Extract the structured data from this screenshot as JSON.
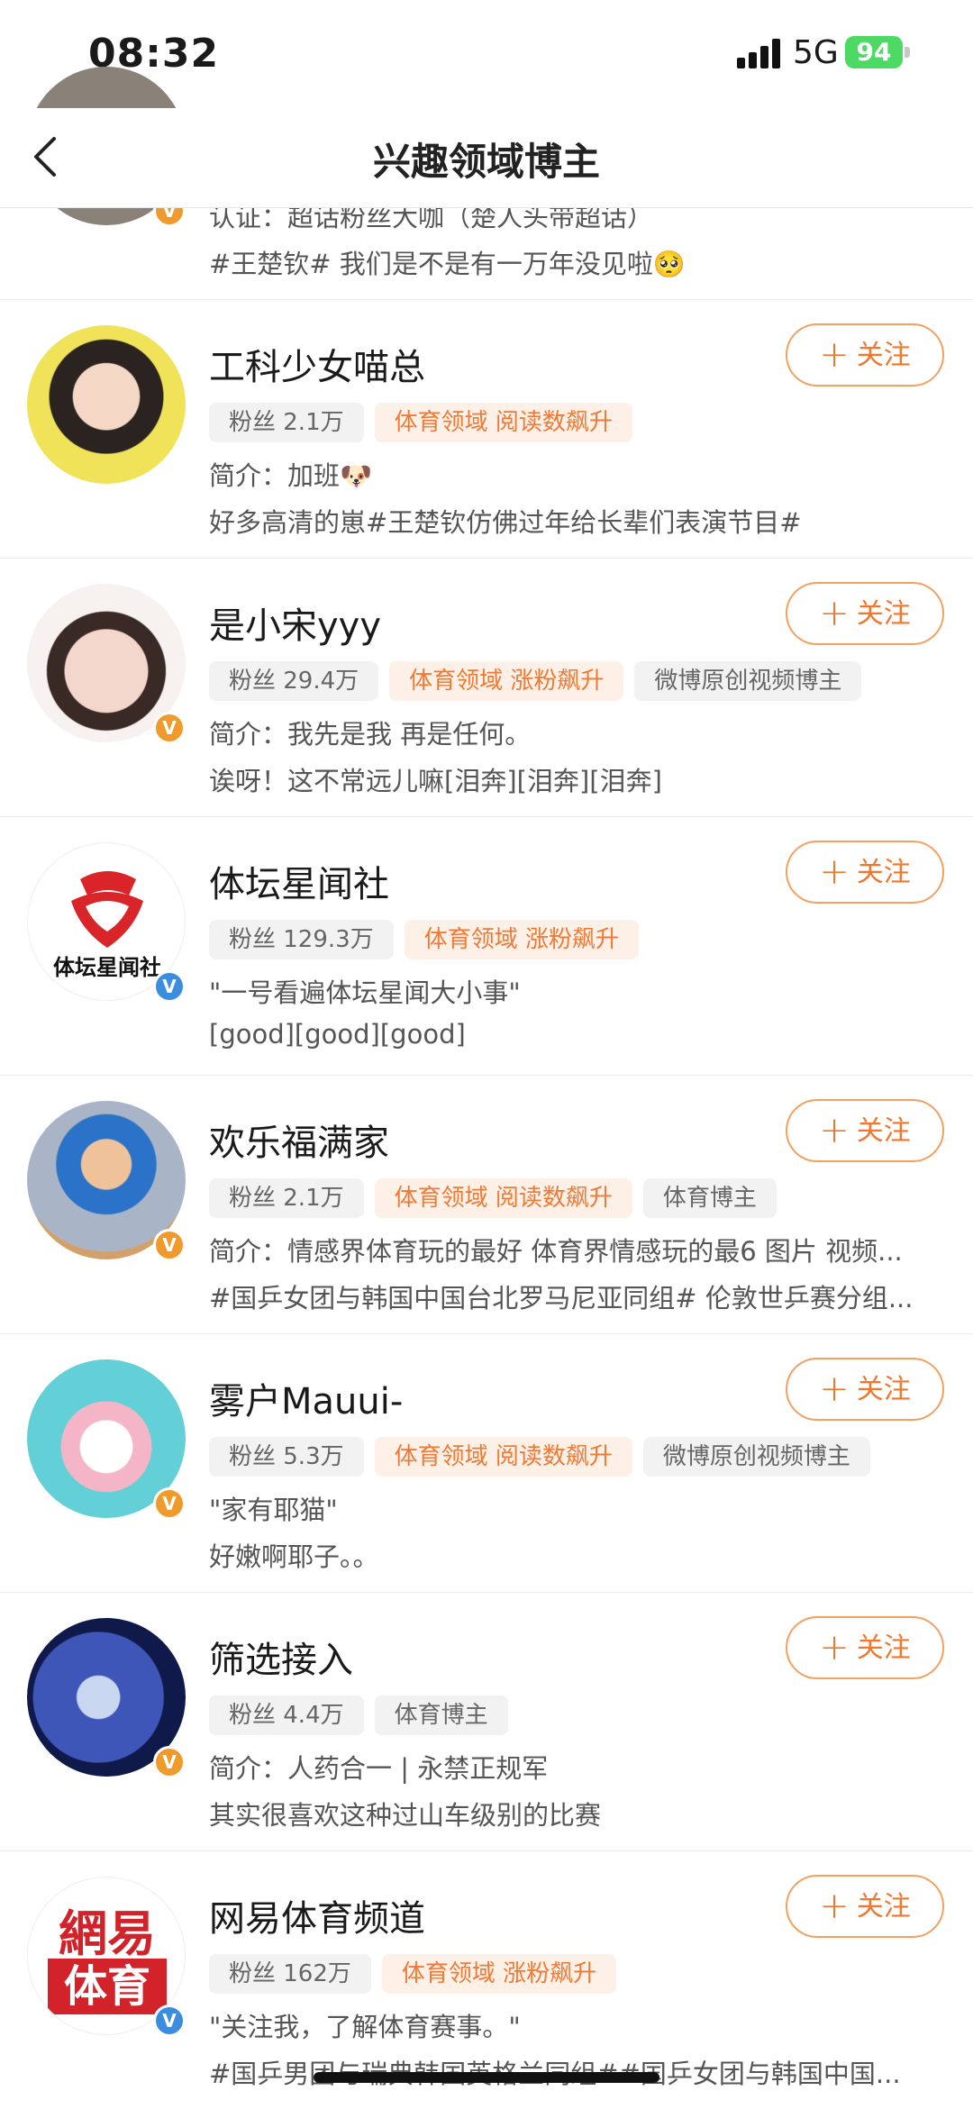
{
  "status": {
    "time": "08:32",
    "network": "5G",
    "battery": "94"
  },
  "nav": {
    "title": "兴趣领域博主"
  },
  "partial_item": {
    "line1": "认证：超话粉丝大咖（楚人头带超话）",
    "line2": "#王楚钦# 我们是不是有一万年没见啦🥺"
  },
  "follow_label": "关注",
  "items": [
    {
      "name": "工科少女喵总",
      "fans": "粉丝 2.1万",
      "tags": [
        "体育领域 阅读数飙升"
      ],
      "line1": "简介：加班🐶",
      "line2": "好多高清的崽#王楚钦仿佛过年给长辈们表演节目#",
      "avatar_text": "",
      "badge": "orange"
    },
    {
      "name": "是小宋yyy",
      "fans": "粉丝 29.4万",
      "tags": [
        "体育领域 涨粉飙升"
      ],
      "extra_tag": "微博原创视频博主",
      "line1": "简介：我先是我 再是任何。",
      "line2": "诶呀！这不常远儿嘛[泪奔][泪奔][泪奔]",
      "badge": "orange"
    },
    {
      "name": "体坛星闻社",
      "fans": "粉丝 129.3万",
      "tags": [
        "体育领域 涨粉飙升"
      ],
      "line1": "\"一号看遍体坛星闻大小事\"",
      "line2": "[good][good][good]",
      "avatar_text": "体坛星闻社",
      "badge": "blue"
    },
    {
      "name": "欢乐福满家",
      "fans": "粉丝 2.1万",
      "tags": [
        "体育领域 阅读数飙升"
      ],
      "extra_tag": "体育博主",
      "line1": "简介：情感界体育玩的最好 体育界情感玩的最6 图片 视频...",
      "line2": "#国乒女团与韩国中国台北罗马尼亚同组# 伦敦世乒赛分组...",
      "badge": "orange"
    },
    {
      "name": "雾户Mauui-",
      "fans": "粉丝 5.3万",
      "tags": [
        "体育领域 阅读数飙升"
      ],
      "extra_tag": "微博原创视频博主",
      "line1": "\"家有耶猫\"",
      "line2": "好嫩啊耶子。。",
      "badge": "orange"
    },
    {
      "name": "筛选接入",
      "fans": "粉丝 4.4万",
      "tags": [],
      "extra_tag": "体育博主",
      "line1": "简介：人药合一 | 永禁正规军",
      "line2": "其实很喜欢这种过山车级别的比赛",
      "badge": "orange"
    },
    {
      "name": "网易体育频道",
      "fans": "粉丝 162万",
      "tags": [
        "体育领域 涨粉飙升"
      ],
      "line1": "\"关注我，了解体育赛事。\"",
      "line2": "#国乒男团与瑞典韩国英格兰同组##国乒女团与韩国中国...",
      "avatar_text_top": "網易",
      "avatar_text_bottom": "体育",
      "badge": "blue"
    }
  ],
  "badges": {
    "orange": "V",
    "blue": "V"
  }
}
